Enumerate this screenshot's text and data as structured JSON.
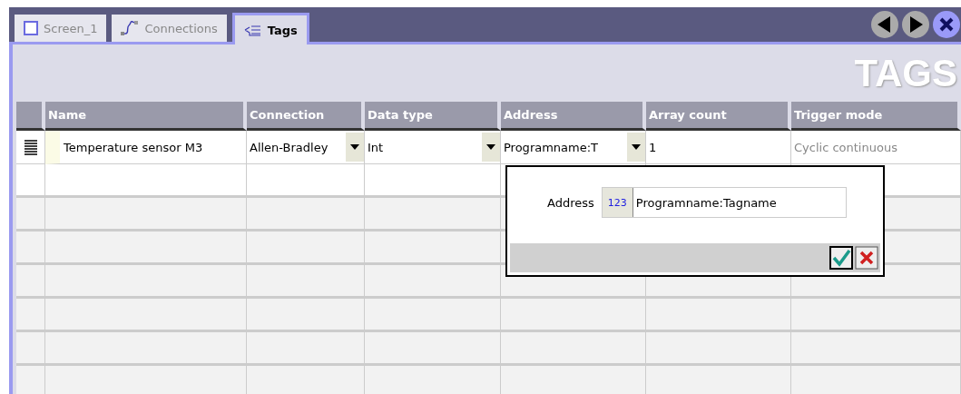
{
  "tabs": [
    {
      "label": "Screen_1",
      "selected": false
    },
    {
      "label": "Connections",
      "selected": false
    },
    {
      "label": "Tags",
      "selected": true
    }
  ],
  "banner": "TAGS",
  "table": {
    "columns": [
      "Name",
      "Connection",
      "Data type",
      "Address",
      "Array count",
      "Trigger mode"
    ],
    "rows": [
      {
        "name": "Temperature sensor M3",
        "connection": "Allen-Bradley",
        "data_type": "Int",
        "address": "Programname:T",
        "array_count": "1",
        "trigger_mode": "Cyclic continuous"
      }
    ]
  },
  "address_popup": {
    "label": "Address",
    "value": "Programname:Tagname",
    "type_icon": "123"
  }
}
